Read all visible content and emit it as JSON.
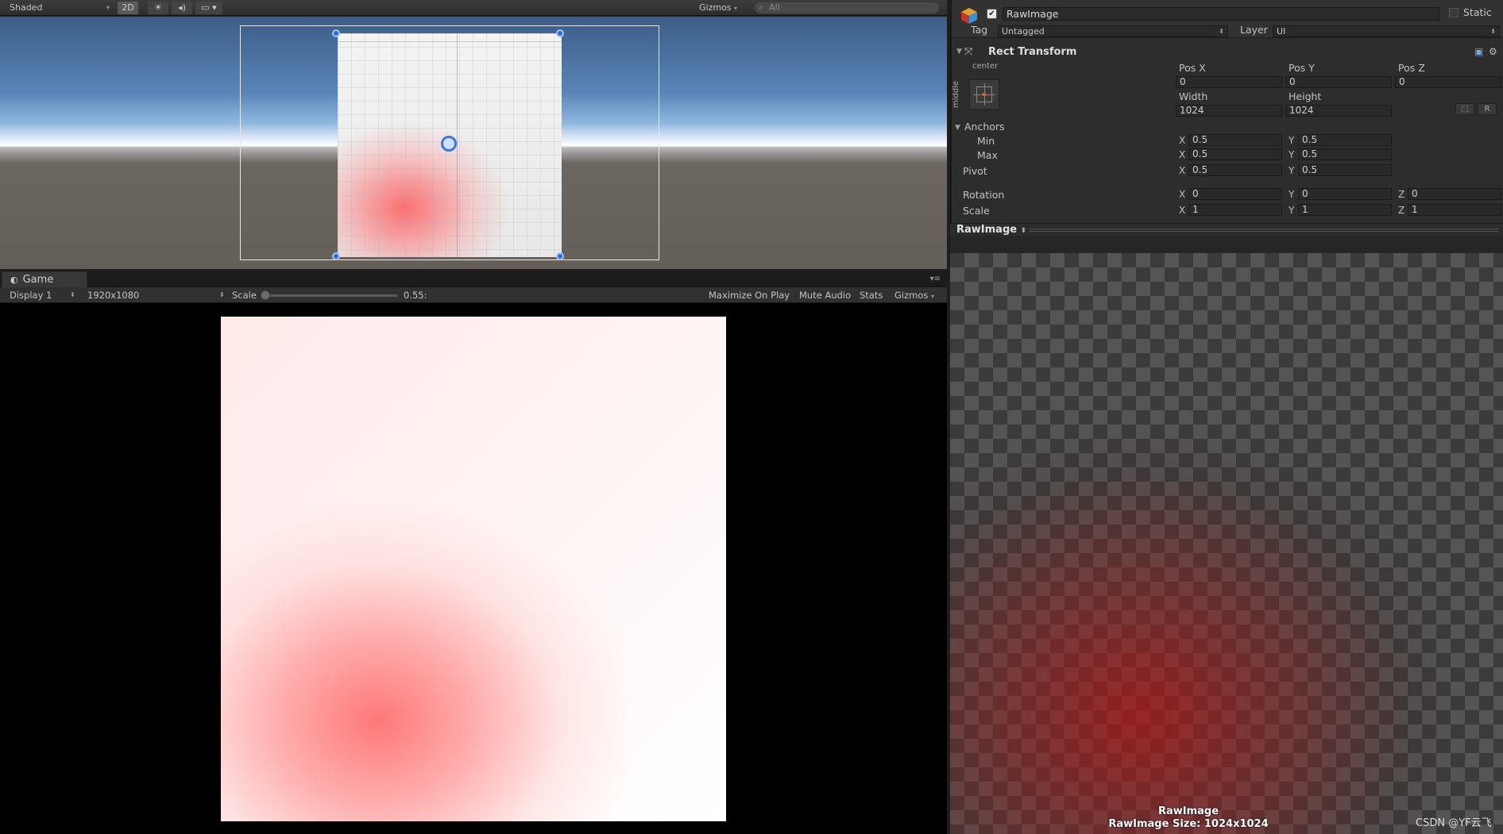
{
  "scene": {
    "shading_mode": "Shaded",
    "mode_2d": "2D",
    "gizmos": "Gizmos",
    "search_placeholder": "All"
  },
  "game": {
    "tab_label": "Game",
    "display": "Display 1",
    "resolution": "1920x1080",
    "scale_label": "Scale",
    "scale_value": "0.55:",
    "maximize_on_play": "Maximize On Play",
    "mute_audio": "Mute Audio",
    "stats": "Stats",
    "gizmos": "Gizmos"
  },
  "inspector": {
    "object_name": "RawImage",
    "active": true,
    "static_label": "Static",
    "tag_label": "Tag",
    "tag_value": "Untagged",
    "layer_label": "Layer",
    "layer_value": "UI",
    "component_title": "Rect Transform",
    "anchor_preset_h": "center",
    "anchor_preset_v": "middle",
    "pos_x_label": "Pos X",
    "pos_y_label": "Pos Y",
    "pos_z_label": "Pos Z",
    "pos_x": "0",
    "pos_y": "0",
    "pos_z": "0",
    "width_label": "Width",
    "height_label": "Height",
    "width": "1024",
    "height": "1024",
    "raw_button": "R",
    "anchors_label": "Anchors",
    "min_label": "Min",
    "max_label": "Max",
    "pivot_label": "Pivot",
    "rotation_label": "Rotation",
    "scale_label": "Scale",
    "axis_x": "X",
    "axis_y": "Y",
    "axis_z": "Z",
    "anchor_min_x": "0.5",
    "anchor_min_y": "0.5",
    "anchor_max_x": "0.5",
    "anchor_max_y": "0.5",
    "pivot_x": "0.5",
    "pivot_y": "0.5",
    "rotation_x": "0",
    "rotation_y": "0",
    "rotation_z": "0",
    "scale_x": "1",
    "scale_y": "1",
    "scale_z": "1"
  },
  "preview": {
    "title": "RawImage",
    "caption_name": "RawImage",
    "caption_size": "RawImage Size: 1024x1024"
  },
  "watermark": "CSDN @YF云飞"
}
